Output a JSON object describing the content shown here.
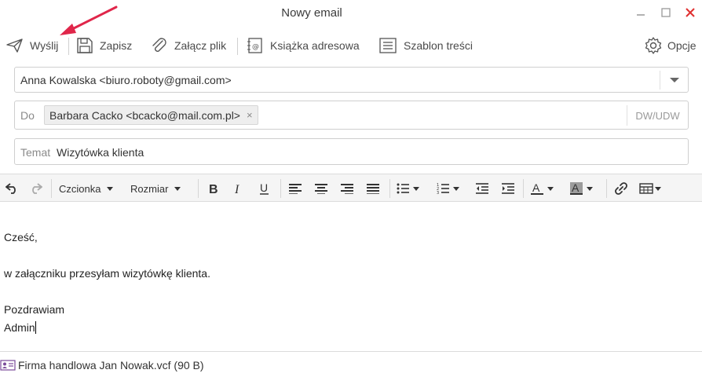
{
  "window": {
    "title": "Nowy email"
  },
  "toolbar": {
    "send_label": "Wyślij",
    "save_label": "Zapisz",
    "attach_label": "Załącz plik",
    "addressbook_label": "Książka adresowa",
    "template_label": "Szablon treści",
    "options_label": "Opcje"
  },
  "compose": {
    "from_value": "Anna Kowalska <biuro.roboty@gmail.com>",
    "to_label": "Do",
    "to_recipients": [
      "Barbara Cacko <bcacko@mail.com.pl>"
    ],
    "to_remove": "×",
    "cc_bcc_label": "DW/UDW",
    "subject_label": "Temat",
    "subject_value": "Wizytówka klienta"
  },
  "format_toolbar": {
    "font_label": "Czcionka",
    "size_label": "Rozmiar"
  },
  "message": {
    "lines": [
      "Cześć,",
      "w załączniku przesyłam wizytówkę klienta.",
      "Pozdrawiam",
      "Admin"
    ]
  },
  "attachment": {
    "name": "Firma handlowa Jan Nowak.vcf (90 B)"
  },
  "colors": {
    "arrow": "#e0264a",
    "close": "#e03030",
    "icon": "#555555"
  }
}
